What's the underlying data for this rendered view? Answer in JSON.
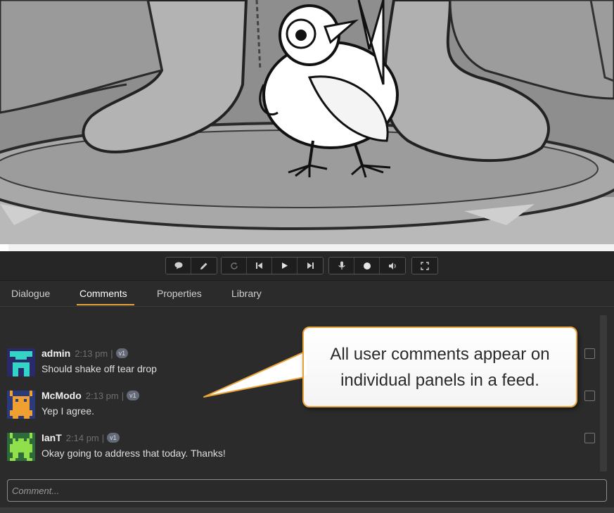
{
  "toolbar": {
    "groups": [
      [
        "comment-icon",
        "pencil-icon"
      ],
      [
        "loop-icon",
        "skip-back-icon",
        "play-icon",
        "skip-forward-icon"
      ],
      [
        "microphone-icon",
        "record-icon",
        "volume-icon"
      ],
      [
        "fullscreen-icon"
      ]
    ]
  },
  "tabs": [
    {
      "label": "Dialogue",
      "active": false
    },
    {
      "label": "Comments",
      "active": true
    },
    {
      "label": "Properties",
      "active": false
    },
    {
      "label": "Library",
      "active": false
    }
  ],
  "comments": [
    {
      "user": "admin",
      "time": "2:13 pm",
      "separator": "|",
      "version": "v1",
      "text": "Should shake off tear drop",
      "avatar_color": "#33d6c4"
    },
    {
      "user": "McModo",
      "time": "2:13 pm",
      "separator": "|",
      "version": "v1",
      "text": "Yep I agree.",
      "avatar_color": "#f0a030"
    },
    {
      "user": "IanT",
      "time": "2:14 pm",
      "separator": "|",
      "version": "v1",
      "text": "Okay going to address that today. Thanks!",
      "avatar_color": "#8fe04a"
    }
  ],
  "comment_input": {
    "placeholder": "Comment..."
  },
  "callout": {
    "text": "All user comments appear on individual panels in a feed."
  },
  "colors": {
    "accent": "#e8a33a",
    "background": "#2b2b2b"
  }
}
